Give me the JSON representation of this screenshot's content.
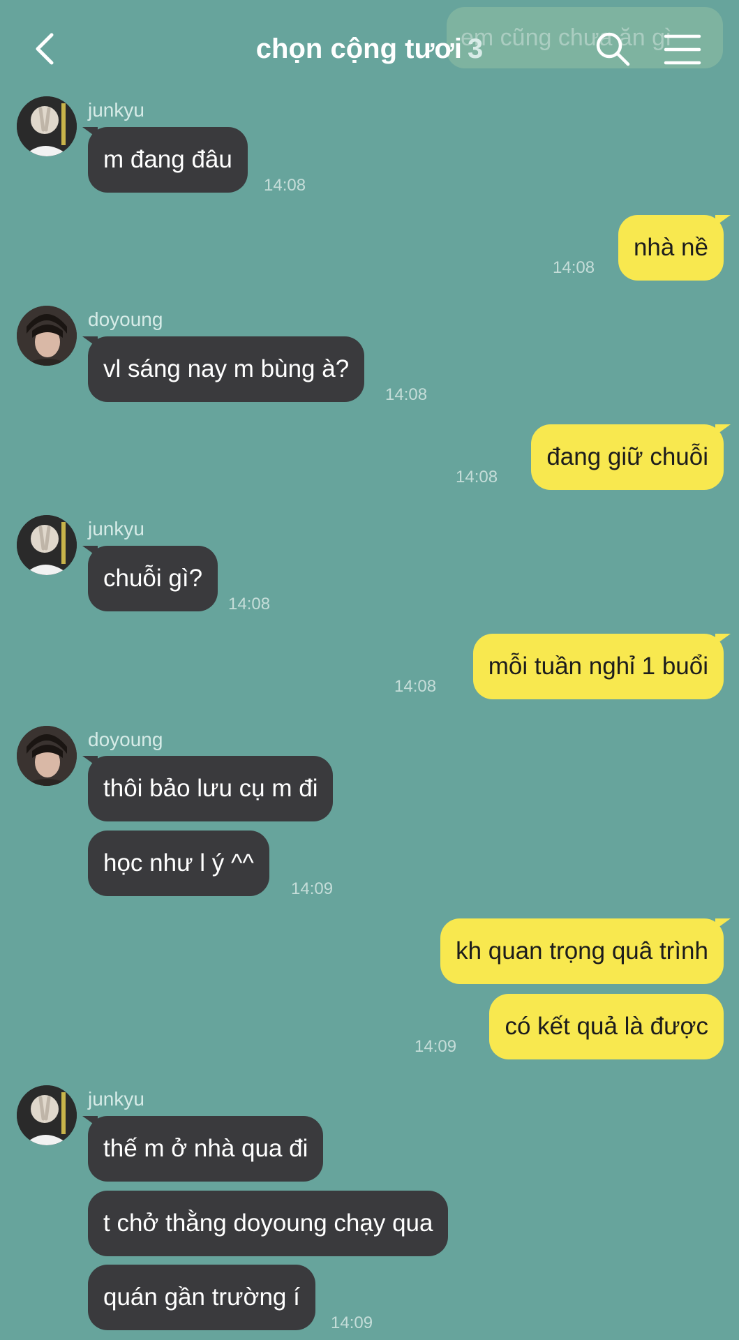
{
  "header": {
    "title": "chọn cộng tươi",
    "member_count": "3",
    "pinned_preview": "em cũng chưa ăn gì"
  },
  "colors": {
    "background": "#67a49c",
    "incoming_bubble": "#3a3a3d",
    "outgoing_bubble": "#f8e84f"
  },
  "messages": [
    {
      "sender": "junkyu",
      "text": "m đang đâu",
      "time": "14:08"
    },
    {
      "text": "nhà nề",
      "time": "14:08"
    },
    {
      "sender": "doyoung",
      "text": "vl sáng nay m bùng à?",
      "time": "14:08"
    },
    {
      "text": "đang giữ chuỗi",
      "time": "14:08"
    },
    {
      "sender": "junkyu",
      "text": "chuỗi gì?",
      "time": "14:08"
    },
    {
      "text": "mỗi tuần nghỉ 1 buổi",
      "time": "14:08"
    },
    {
      "sender": "doyoung",
      "text": "thôi bảo lưu cụ m đi"
    },
    {
      "text": "học như l ý ^^",
      "time": "14:09"
    },
    {
      "text": "kh quan trọng quâ trình"
    },
    {
      "text": "có kết quả là được",
      "time": "14:09"
    },
    {
      "sender": "junkyu",
      "text": "thế m ở nhà qua đi"
    },
    {
      "text": "t chở thằng doyoung chạy qua"
    },
    {
      "text": "quán gần trường í",
      "time": "14:09"
    }
  ]
}
